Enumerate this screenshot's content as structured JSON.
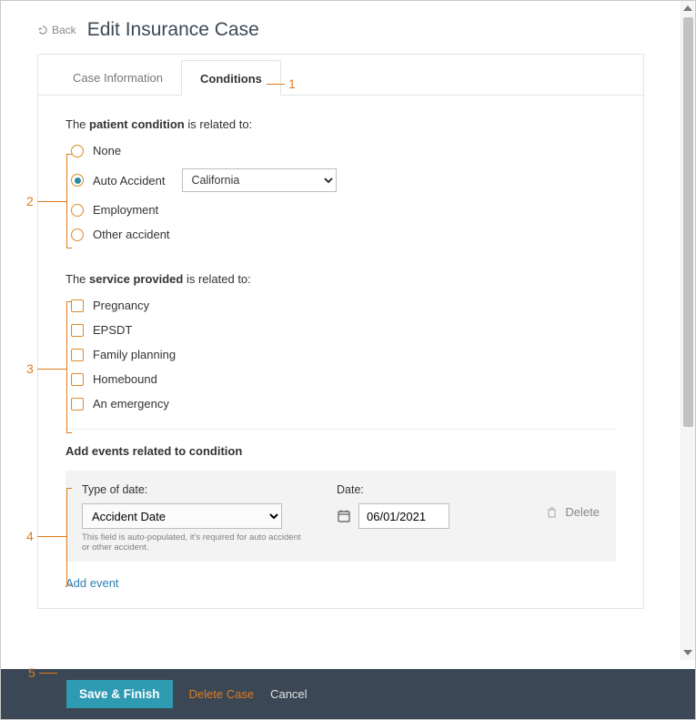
{
  "header": {
    "back_label": "Back",
    "title": "Edit Insurance Case"
  },
  "tabs": [
    {
      "label": "Case Information"
    },
    {
      "label": "Conditions"
    }
  ],
  "patient_condition": {
    "prompt_prefix": "The ",
    "prompt_bold": "patient condition",
    "prompt_suffix": " is related to:",
    "options": {
      "none": "None",
      "auto_accident": "Auto Accident",
      "employment": "Employment",
      "other_accident": "Other accident"
    },
    "state_selected": "California"
  },
  "service_provided": {
    "prompt_prefix": "The ",
    "prompt_bold": "service provided",
    "prompt_suffix": " is related to:",
    "options": {
      "pregnancy": "Pregnancy",
      "epsdt": "EPSDT",
      "family_planning": "Family planning",
      "homebound": "Homebound",
      "emergency": "An emergency"
    }
  },
  "events": {
    "heading": "Add events related to condition",
    "type_label": "Type of date:",
    "date_label": "Date:",
    "type_value": "Accident Date",
    "date_value": "06/01/2021",
    "hint": "This field is auto-populated, it's required for auto accident or other accident.",
    "delete_label": "Delete",
    "add_label": "Add event"
  },
  "footer": {
    "save": "Save & Finish",
    "delete": "Delete Case",
    "cancel": "Cancel"
  },
  "annotations": {
    "n1": "1",
    "n2": "2",
    "n3": "3",
    "n4": "4",
    "n5": "5"
  },
  "colors": {
    "accent_orange": "#e07b1e",
    "accent_teal": "#2f9bb3"
  }
}
